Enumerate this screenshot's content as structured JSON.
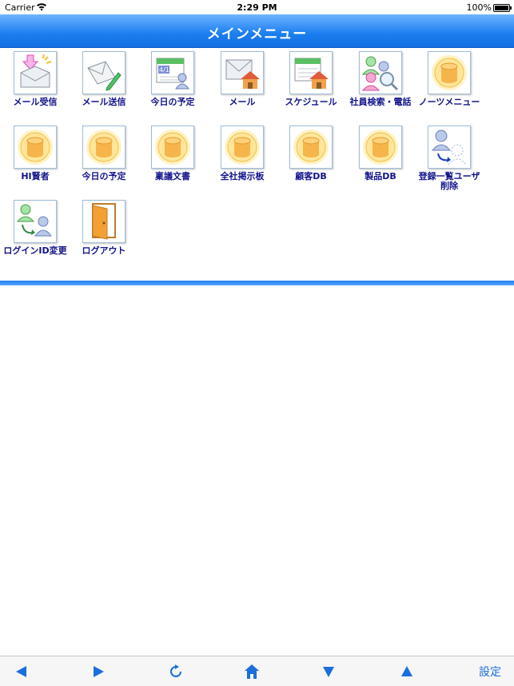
{
  "status_bar": {
    "carrier": "Carrier",
    "time": "2:29 PM",
    "battery": "100%"
  },
  "header": {
    "title": "メインメニュー"
  },
  "menu": {
    "items": [
      {
        "label": "メール受信",
        "icon": "mail-receive-icon"
      },
      {
        "label": "メール送信",
        "icon": "mail-send-icon"
      },
      {
        "label": "今日の予定",
        "icon": "calendar-user-icon"
      },
      {
        "label": "メール",
        "icon": "mail-home-icon"
      },
      {
        "label": "スケジュール",
        "icon": "schedule-home-icon"
      },
      {
        "label": "社員検索・電話",
        "icon": "people-search-icon"
      },
      {
        "label": "ノーツメニュー",
        "icon": "database-icon"
      },
      {
        "label": "HI賢者",
        "icon": "database-icon"
      },
      {
        "label": "今日の予定",
        "icon": "database-icon"
      },
      {
        "label": "稟議文書",
        "icon": "database-icon"
      },
      {
        "label": "全社掲示板",
        "icon": "database-icon"
      },
      {
        "label": "顧客DB",
        "icon": "database-icon"
      },
      {
        "label": "製品DB",
        "icon": "database-icon"
      },
      {
        "label": "登録一覧ユーザ削除",
        "icon": "user-delete-icon"
      },
      {
        "label": "ログインID変更",
        "icon": "user-change-icon"
      },
      {
        "label": "ログアウト",
        "icon": "door-exit-icon"
      }
    ]
  },
  "toolbar": {
    "buttons": [
      {
        "name": "back-button",
        "icon": "arrow-left-icon"
      },
      {
        "name": "forward-button",
        "icon": "arrow-right-icon"
      },
      {
        "name": "reload-button",
        "icon": "reload-icon"
      },
      {
        "name": "home-button",
        "icon": "home-icon"
      },
      {
        "name": "scroll-down-button",
        "icon": "arrow-down-icon"
      },
      {
        "name": "scroll-up-button",
        "icon": "arrow-up-icon"
      }
    ],
    "settings_label": "設定"
  },
  "colors": {
    "header_blue": "#1a7df0",
    "label_navy": "#13138c",
    "toolbar_blue": "#1a6fdc"
  }
}
